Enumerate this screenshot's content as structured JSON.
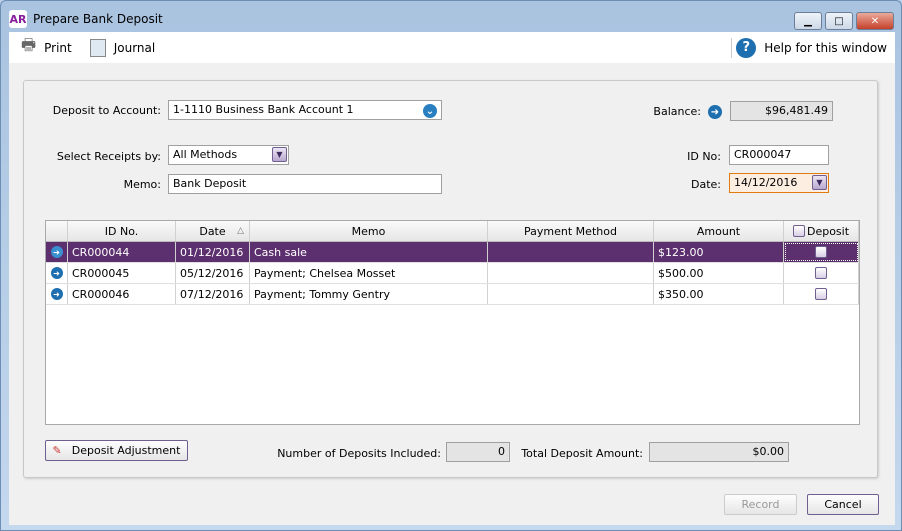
{
  "window": {
    "title": "Prepare Bank Deposit",
    "logo": "AR"
  },
  "toolbar": {
    "print": "Print",
    "journal": "Journal",
    "help": "Help for this window"
  },
  "form": {
    "deposit_to_label": "Deposit to Account:",
    "deposit_to_value": "1-1110 Business Bank Account 1",
    "select_receipts_label": "Select Receipts by:",
    "select_receipts_value": "All Methods",
    "memo_label": "Memo:",
    "memo_value": "Bank Deposit",
    "balance_label": "Balance:",
    "balance_value": "$96,481.49",
    "id_label": "ID No:",
    "id_value": "CR000047",
    "date_label": "Date:",
    "date_value": "14/12/2016"
  },
  "grid": {
    "columns": [
      "ID No.",
      "Date",
      "Memo",
      "Payment Method",
      "Amount",
      "Deposit"
    ],
    "rows": [
      {
        "id": "CR000044",
        "date": "01/12/2016",
        "memo": "Cash sale",
        "method": "",
        "amount": "$123.00",
        "deposit": false,
        "selected": true
      },
      {
        "id": "CR000045",
        "date": "05/12/2016",
        "memo": "Payment; Chelsea Mosset",
        "method": "",
        "amount": "$500.00",
        "deposit": false
      },
      {
        "id": "CR000046",
        "date": "07/12/2016",
        "memo": "Payment; Tommy Gentry",
        "method": "",
        "amount": "$350.00",
        "deposit": false
      }
    ]
  },
  "footer": {
    "deposit_adjustment": "Deposit Adjustment",
    "num_label": "Number of Deposits Included:",
    "num_value": "0",
    "total_label": "Total Deposit Amount:",
    "total_value": "$0.00",
    "record": "Record",
    "cancel": "Cancel"
  }
}
